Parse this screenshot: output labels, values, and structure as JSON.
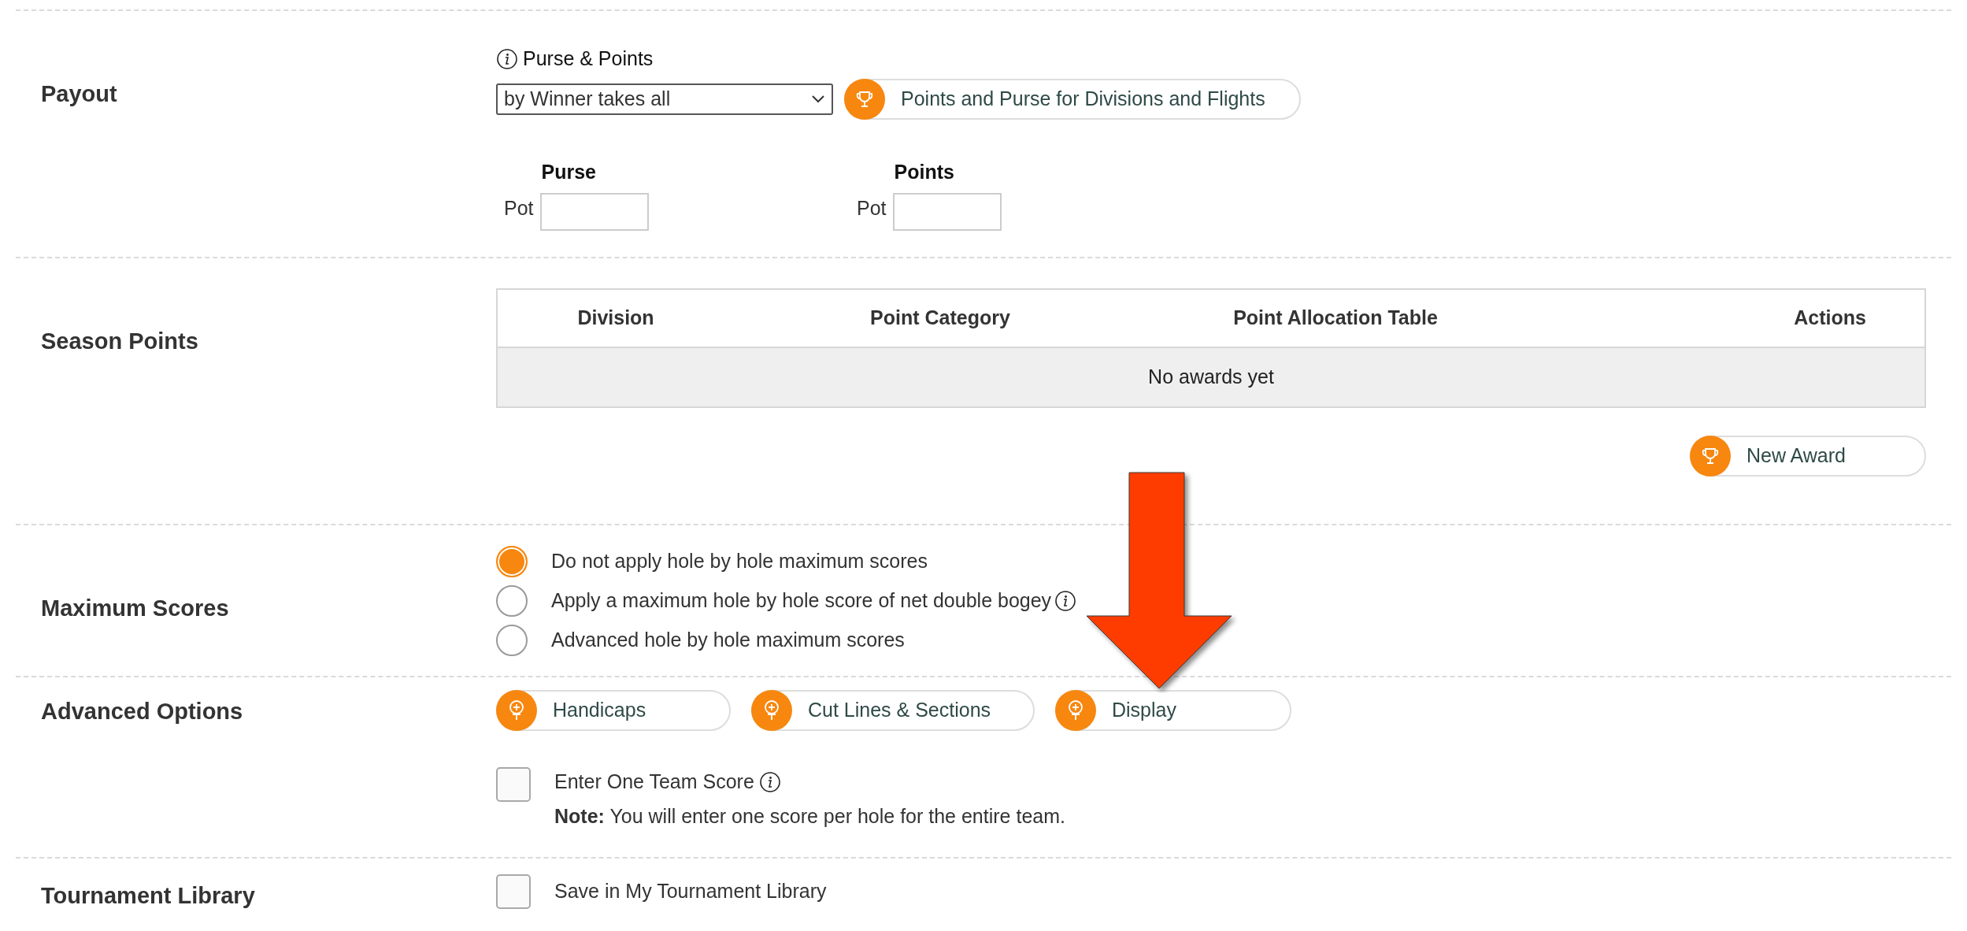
{
  "payout": {
    "label": "Payout",
    "info_label": "Purse & Points",
    "select_value": "by Winner takes all",
    "link_button": "Points and Purse for Divisions and Flights",
    "columns": [
      {
        "heading": "Purse",
        "field_label": "Pot"
      },
      {
        "heading": "Points",
        "field_label": "Pot"
      }
    ]
  },
  "season_points": {
    "label": "Season Points",
    "columns": [
      "Division",
      "Point Category",
      "Point Allocation Table",
      "Actions"
    ],
    "empty_message": "No awards yet",
    "new_button": "New Award"
  },
  "maximum_scores": {
    "label": "Maximum Scores",
    "options": [
      {
        "label": "Do not apply hole by hole maximum scores",
        "selected": true,
        "info": false
      },
      {
        "label": "Apply a maximum hole by hole score of net double bogey",
        "selected": false,
        "info": true
      },
      {
        "label": "Advanced hole by hole maximum scores",
        "selected": false,
        "info": false
      }
    ]
  },
  "advanced_options": {
    "label": "Advanced Options",
    "buttons": [
      "Handicaps",
      "Cut Lines & Sections",
      "Display"
    ],
    "checkbox": {
      "label": "Enter One Team Score",
      "checked": false
    },
    "note": "**Note:** You will enter one score per hole for the entire team."
  },
  "tournament_library": {
    "label": "Tournament Library",
    "checkbox": {
      "label": "Save in My Tournament Library",
      "checked": false
    }
  }
}
